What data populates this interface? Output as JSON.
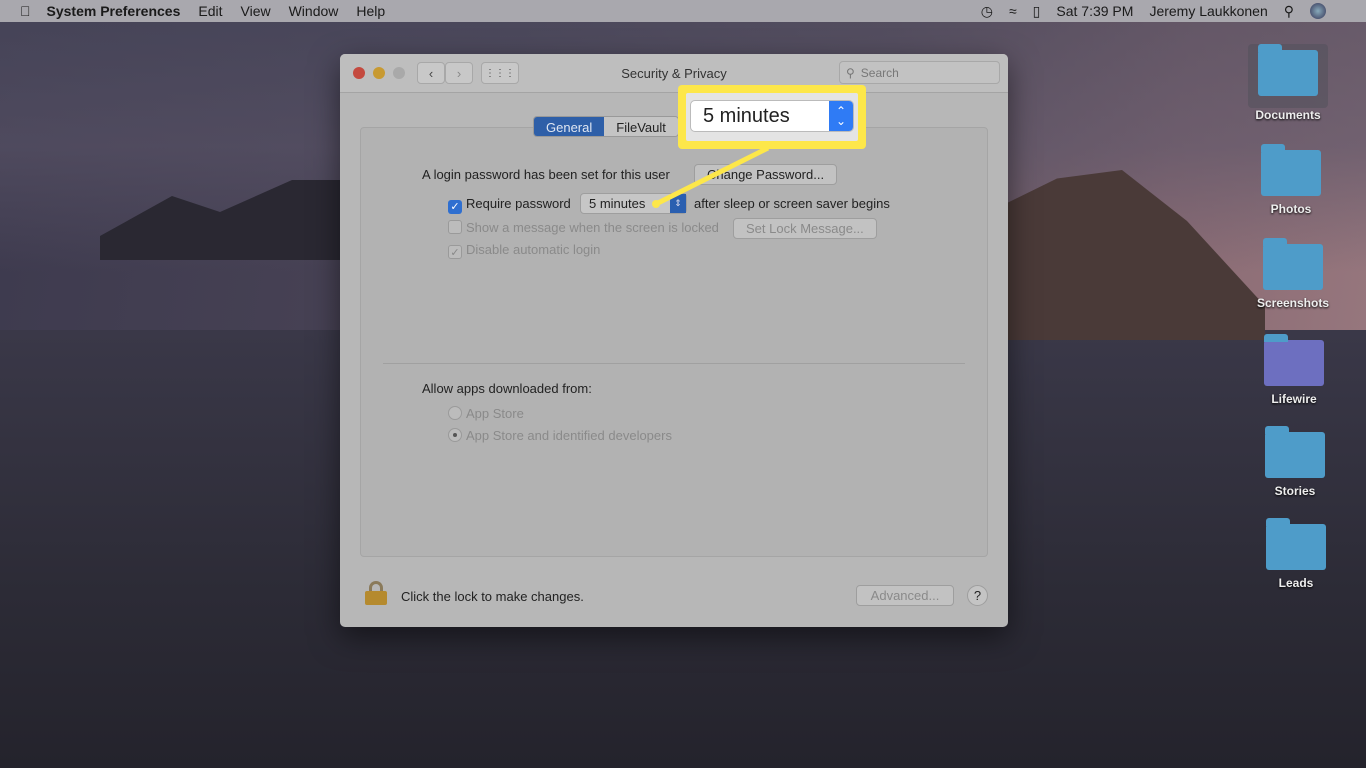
{
  "menubar": {
    "app": "System Preferences",
    "items": [
      "Edit",
      "View",
      "Window",
      "Help"
    ],
    "clock": "Sat 7:39 PM",
    "user": "Jeremy Laukkonen"
  },
  "window": {
    "title": "Security & Privacy",
    "search_placeholder": "Search",
    "tabs": [
      "General",
      "FileVault"
    ],
    "active_tab": "General",
    "login_text": "A login password has been set for this user",
    "change_password": "Change Password...",
    "require_password": {
      "label": "Require password",
      "checked": true,
      "value": "5 minutes",
      "suffix": "after sleep or screen saver begins"
    },
    "show_message": {
      "label": "Show a message when the screen is locked",
      "checked": false,
      "button": "Set Lock Message..."
    },
    "disable_login": {
      "label": "Disable automatic login",
      "checked": true
    },
    "allow_apps": {
      "label": "Allow apps downloaded from:",
      "options": [
        "App Store",
        "App Store and identified developers"
      ],
      "selected": "App Store and identified developers"
    },
    "lock_text": "Click the lock to make changes.",
    "advanced": "Advanced...",
    "help": "?"
  },
  "callout": {
    "value": "5 minutes",
    "color": "#fde74a"
  },
  "desktop": [
    "Documents",
    "Photos",
    "Screenshots",
    "Lifewire",
    "Stories",
    "Leads"
  ]
}
